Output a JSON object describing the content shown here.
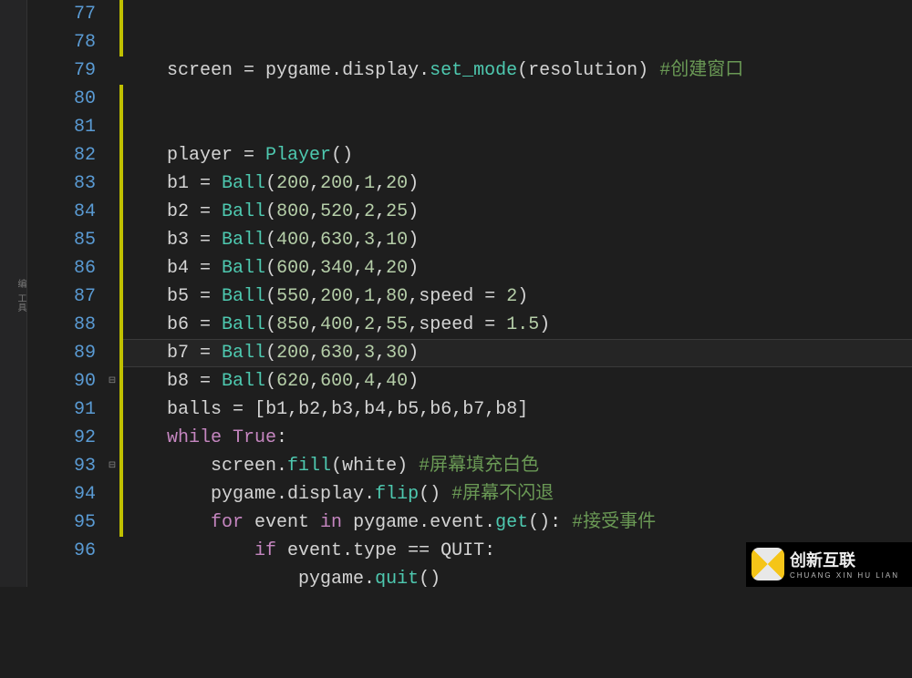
{
  "sidebar": {
    "label": "编 工具"
  },
  "lines": [
    {
      "n": 77,
      "mod": true,
      "fold": " ",
      "tokens": [
        {
          "cls": "",
          "t": "    "
        },
        {
          "cls": "tk-var",
          "t": "screen "
        },
        {
          "cls": "tk-op",
          "t": "= "
        },
        {
          "cls": "tk-var",
          "t": "pygame"
        },
        {
          "cls": "tk-op",
          "t": "."
        },
        {
          "cls": "tk-var",
          "t": "display"
        },
        {
          "cls": "tk-op",
          "t": "."
        },
        {
          "cls": "tk-fn",
          "t": "set_mode"
        },
        {
          "cls": "tk-op",
          "t": "("
        },
        {
          "cls": "tk-var",
          "t": "resolution"
        },
        {
          "cls": "tk-op",
          "t": ") "
        },
        {
          "cls": "tk-cmt",
          "t": "#创建窗口"
        }
      ]
    },
    {
      "n": 78,
      "mod": true,
      "fold": " ",
      "tokens": []
    },
    {
      "n": 79,
      "mod": false,
      "fold": " ",
      "tokens": []
    },
    {
      "n": 80,
      "mod": true,
      "fold": " ",
      "tokens": [
        {
          "cls": "",
          "t": "    "
        },
        {
          "cls": "tk-var",
          "t": "player "
        },
        {
          "cls": "tk-op",
          "t": "= "
        },
        {
          "cls": "tk-fn",
          "t": "Player"
        },
        {
          "cls": "tk-op",
          "t": "()"
        }
      ]
    },
    {
      "n": 81,
      "mod": true,
      "fold": " ",
      "tokens": [
        {
          "cls": "",
          "t": "    "
        },
        {
          "cls": "tk-var",
          "t": "b1 "
        },
        {
          "cls": "tk-op",
          "t": "= "
        },
        {
          "cls": "tk-fn",
          "t": "Ball"
        },
        {
          "cls": "tk-op",
          "t": "("
        },
        {
          "cls": "tk-num",
          "t": "200"
        },
        {
          "cls": "tk-op",
          "t": ","
        },
        {
          "cls": "tk-num",
          "t": "200"
        },
        {
          "cls": "tk-op",
          "t": ","
        },
        {
          "cls": "tk-num",
          "t": "1"
        },
        {
          "cls": "tk-op",
          "t": ","
        },
        {
          "cls": "tk-num",
          "t": "20"
        },
        {
          "cls": "tk-op",
          "t": ")"
        }
      ]
    },
    {
      "n": 82,
      "mod": true,
      "fold": " ",
      "tokens": [
        {
          "cls": "",
          "t": "    "
        },
        {
          "cls": "tk-var",
          "t": "b2 "
        },
        {
          "cls": "tk-op",
          "t": "= "
        },
        {
          "cls": "tk-fn",
          "t": "Ball"
        },
        {
          "cls": "tk-op",
          "t": "("
        },
        {
          "cls": "tk-num",
          "t": "800"
        },
        {
          "cls": "tk-op",
          "t": ","
        },
        {
          "cls": "tk-num",
          "t": "520"
        },
        {
          "cls": "tk-op",
          "t": ","
        },
        {
          "cls": "tk-num",
          "t": "2"
        },
        {
          "cls": "tk-op",
          "t": ","
        },
        {
          "cls": "tk-num",
          "t": "25"
        },
        {
          "cls": "tk-op",
          "t": ")"
        }
      ]
    },
    {
      "n": 83,
      "mod": true,
      "fold": " ",
      "tokens": [
        {
          "cls": "",
          "t": "    "
        },
        {
          "cls": "tk-var",
          "t": "b3 "
        },
        {
          "cls": "tk-op",
          "t": "= "
        },
        {
          "cls": "tk-fn",
          "t": "Ball"
        },
        {
          "cls": "tk-op",
          "t": "("
        },
        {
          "cls": "tk-num",
          "t": "400"
        },
        {
          "cls": "tk-op",
          "t": ","
        },
        {
          "cls": "tk-num",
          "t": "630"
        },
        {
          "cls": "tk-op",
          "t": ","
        },
        {
          "cls": "tk-num",
          "t": "3"
        },
        {
          "cls": "tk-op",
          "t": ","
        },
        {
          "cls": "tk-num",
          "t": "10"
        },
        {
          "cls": "tk-op",
          "t": ")"
        }
      ]
    },
    {
      "n": 84,
      "mod": true,
      "fold": " ",
      "tokens": [
        {
          "cls": "",
          "t": "    "
        },
        {
          "cls": "tk-var",
          "t": "b4 "
        },
        {
          "cls": "tk-op",
          "t": "= "
        },
        {
          "cls": "tk-fn",
          "t": "Ball"
        },
        {
          "cls": "tk-op",
          "t": "("
        },
        {
          "cls": "tk-num",
          "t": "600"
        },
        {
          "cls": "tk-op",
          "t": ","
        },
        {
          "cls": "tk-num",
          "t": "340"
        },
        {
          "cls": "tk-op",
          "t": ","
        },
        {
          "cls": "tk-num",
          "t": "4"
        },
        {
          "cls": "tk-op",
          "t": ","
        },
        {
          "cls": "tk-num",
          "t": "20"
        },
        {
          "cls": "tk-op",
          "t": ")"
        }
      ]
    },
    {
      "n": 85,
      "mod": true,
      "fold": " ",
      "tokens": [
        {
          "cls": "",
          "t": "    "
        },
        {
          "cls": "tk-var",
          "t": "b5 "
        },
        {
          "cls": "tk-op",
          "t": "= "
        },
        {
          "cls": "tk-fn",
          "t": "Ball"
        },
        {
          "cls": "tk-op",
          "t": "("
        },
        {
          "cls": "tk-num",
          "t": "550"
        },
        {
          "cls": "tk-op",
          "t": ","
        },
        {
          "cls": "tk-num",
          "t": "200"
        },
        {
          "cls": "tk-op",
          "t": ","
        },
        {
          "cls": "tk-num",
          "t": "1"
        },
        {
          "cls": "tk-op",
          "t": ","
        },
        {
          "cls": "tk-num",
          "t": "80"
        },
        {
          "cls": "tk-op",
          "t": ","
        },
        {
          "cls": "tk-var",
          "t": "speed "
        },
        {
          "cls": "tk-op",
          "t": "= "
        },
        {
          "cls": "tk-num",
          "t": "2"
        },
        {
          "cls": "tk-op",
          "t": ")"
        }
      ]
    },
    {
      "n": 86,
      "mod": true,
      "fold": " ",
      "tokens": [
        {
          "cls": "",
          "t": "    "
        },
        {
          "cls": "tk-var",
          "t": "b6 "
        },
        {
          "cls": "tk-op",
          "t": "= "
        },
        {
          "cls": "tk-fn",
          "t": "Ball"
        },
        {
          "cls": "tk-op",
          "t": "("
        },
        {
          "cls": "tk-num",
          "t": "850"
        },
        {
          "cls": "tk-op",
          "t": ","
        },
        {
          "cls": "tk-num",
          "t": "400"
        },
        {
          "cls": "tk-op",
          "t": ","
        },
        {
          "cls": "tk-num",
          "t": "2"
        },
        {
          "cls": "tk-op",
          "t": ","
        },
        {
          "cls": "tk-num",
          "t": "55"
        },
        {
          "cls": "tk-op",
          "t": ","
        },
        {
          "cls": "tk-var",
          "t": "speed "
        },
        {
          "cls": "tk-op",
          "t": "= "
        },
        {
          "cls": "tk-num",
          "t": "1.5"
        },
        {
          "cls": "tk-op",
          "t": ")"
        }
      ]
    },
    {
      "n": 87,
      "mod": true,
      "fold": " ",
      "tokens": [
        {
          "cls": "",
          "t": "    "
        },
        {
          "cls": "tk-var",
          "t": "b7 "
        },
        {
          "cls": "tk-op",
          "t": "= "
        },
        {
          "cls": "tk-fn",
          "t": "Ball"
        },
        {
          "cls": "tk-op",
          "t": "("
        },
        {
          "cls": "tk-num",
          "t": "200"
        },
        {
          "cls": "tk-op",
          "t": ","
        },
        {
          "cls": "tk-num",
          "t": "630"
        },
        {
          "cls": "tk-op",
          "t": ","
        },
        {
          "cls": "tk-num",
          "t": "3"
        },
        {
          "cls": "tk-op",
          "t": ","
        },
        {
          "cls": "tk-num",
          "t": "30"
        },
        {
          "cls": "tk-op",
          "t": ")"
        }
      ]
    },
    {
      "n": 88,
      "mod": true,
      "fold": " ",
      "tokens": [
        {
          "cls": "",
          "t": "    "
        },
        {
          "cls": "tk-var",
          "t": "b8 "
        },
        {
          "cls": "tk-op",
          "t": "= "
        },
        {
          "cls": "tk-fn",
          "t": "Ball"
        },
        {
          "cls": "tk-op",
          "t": "("
        },
        {
          "cls": "tk-num",
          "t": "620"
        },
        {
          "cls": "tk-op",
          "t": ","
        },
        {
          "cls": "tk-num",
          "t": "600"
        },
        {
          "cls": "tk-op",
          "t": ","
        },
        {
          "cls": "tk-num",
          "t": "4"
        },
        {
          "cls": "tk-op",
          "t": ","
        },
        {
          "cls": "tk-num",
          "t": "40"
        },
        {
          "cls": "tk-op",
          "t": ")"
        }
      ]
    },
    {
      "n": 89,
      "mod": true,
      "fold": " ",
      "current": true,
      "tokens": [
        {
          "cls": "",
          "t": "    "
        },
        {
          "cls": "tk-var",
          "t": "balls "
        },
        {
          "cls": "tk-op",
          "t": "= "
        },
        {
          "cls": "tk-op",
          "t": "["
        },
        {
          "cls": "tk-var",
          "t": "b1"
        },
        {
          "cls": "tk-op",
          "t": ","
        },
        {
          "cls": "tk-var",
          "t": "b2"
        },
        {
          "cls": "tk-op",
          "t": ","
        },
        {
          "cls": "tk-var",
          "t": "b3"
        },
        {
          "cls": "tk-op",
          "t": ","
        },
        {
          "cls": "tk-var",
          "t": "b4"
        },
        {
          "cls": "tk-op",
          "t": ","
        },
        {
          "cls": "tk-var",
          "t": "b5"
        },
        {
          "cls": "tk-op",
          "t": ","
        },
        {
          "cls": "tk-var",
          "t": "b6"
        },
        {
          "cls": "tk-op",
          "t": ","
        },
        {
          "cls": "tk-var",
          "t": "b7"
        },
        {
          "cls": "tk-op",
          "t": ","
        },
        {
          "cls": "tk-var",
          "t": "b8"
        },
        {
          "cls": "tk-op",
          "t": "]"
        }
      ]
    },
    {
      "n": 90,
      "mod": true,
      "fold": "⊟",
      "tokens": [
        {
          "cls": "",
          "t": "    "
        },
        {
          "cls": "tk-kw",
          "t": "while "
        },
        {
          "cls": "tk-kw",
          "t": "True"
        },
        {
          "cls": "tk-op",
          "t": ":"
        }
      ]
    },
    {
      "n": 91,
      "mod": true,
      "fold": " ",
      "tokens": [
        {
          "cls": "",
          "t": "        "
        },
        {
          "cls": "tk-var",
          "t": "screen"
        },
        {
          "cls": "tk-op",
          "t": "."
        },
        {
          "cls": "tk-fn",
          "t": "fill"
        },
        {
          "cls": "tk-op",
          "t": "("
        },
        {
          "cls": "tk-var",
          "t": "white"
        },
        {
          "cls": "tk-op",
          "t": ") "
        },
        {
          "cls": "tk-cmt",
          "t": "#屏幕填充白色"
        }
      ]
    },
    {
      "n": 92,
      "mod": true,
      "fold": " ",
      "tokens": [
        {
          "cls": "",
          "t": "        "
        },
        {
          "cls": "tk-var",
          "t": "pygame"
        },
        {
          "cls": "tk-op",
          "t": "."
        },
        {
          "cls": "tk-var",
          "t": "display"
        },
        {
          "cls": "tk-op",
          "t": "."
        },
        {
          "cls": "tk-fn",
          "t": "flip"
        },
        {
          "cls": "tk-op",
          "t": "() "
        },
        {
          "cls": "tk-cmt",
          "t": "#屏幕不闪退"
        }
      ]
    },
    {
      "n": 93,
      "mod": true,
      "fold": "⊟",
      "tokens": [
        {
          "cls": "",
          "t": "        "
        },
        {
          "cls": "tk-kw",
          "t": "for "
        },
        {
          "cls": "tk-var",
          "t": "event "
        },
        {
          "cls": "tk-kw",
          "t": "in "
        },
        {
          "cls": "tk-var",
          "t": "pygame"
        },
        {
          "cls": "tk-op",
          "t": "."
        },
        {
          "cls": "tk-var",
          "t": "event"
        },
        {
          "cls": "tk-op",
          "t": "."
        },
        {
          "cls": "tk-fn",
          "t": "get"
        },
        {
          "cls": "tk-op",
          "t": "(): "
        },
        {
          "cls": "tk-cmt",
          "t": "#接受事件"
        }
      ]
    },
    {
      "n": 94,
      "mod": true,
      "fold": " ",
      "tokens": [
        {
          "cls": "",
          "t": "            "
        },
        {
          "cls": "tk-kw",
          "t": "if "
        },
        {
          "cls": "tk-var",
          "t": "event"
        },
        {
          "cls": "tk-op",
          "t": "."
        },
        {
          "cls": "tk-var",
          "t": "type "
        },
        {
          "cls": "tk-op",
          "t": "== "
        },
        {
          "cls": "tk-var",
          "t": "QUIT"
        },
        {
          "cls": "tk-op",
          "t": ":"
        }
      ]
    },
    {
      "n": 95,
      "mod": true,
      "fold": " ",
      "tokens": [
        {
          "cls": "",
          "t": "                "
        },
        {
          "cls": "tk-var",
          "t": "pygame"
        },
        {
          "cls": "tk-op",
          "t": "."
        },
        {
          "cls": "tk-fn",
          "t": "quit"
        },
        {
          "cls": "tk-op",
          "t": "()"
        }
      ]
    },
    {
      "n": 96,
      "mod": false,
      "fold": " ",
      "tokens": []
    }
  ],
  "watermark": {
    "main": "创新互联",
    "sub": "CHUANG XIN HU LIAN"
  }
}
